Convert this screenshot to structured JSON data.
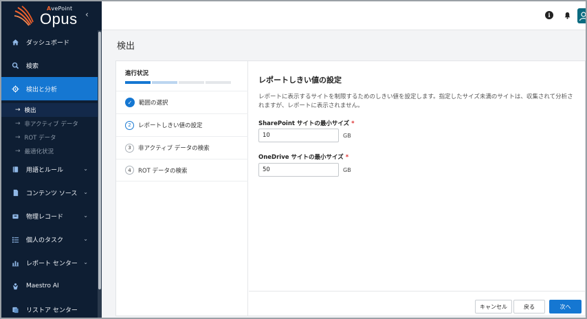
{
  "brand": {
    "company_prefix": "A",
    "company_rest": "vePoint",
    "product": "Opus"
  },
  "sidebar": {
    "collapse_glyph": "‹",
    "items": [
      {
        "label": "ダッシュボード",
        "icon": "home-icon"
      },
      {
        "label": "検索",
        "icon": "search-icon"
      },
      {
        "label": "検出と分析",
        "icon": "target-icon",
        "active": true
      },
      {
        "label": "用語とルール",
        "icon": "book-icon"
      },
      {
        "label": "コンテンツ ソース",
        "icon": "file-icon"
      },
      {
        "label": "物理レコード",
        "icon": "box-icon"
      },
      {
        "label": "個人のタスク",
        "icon": "list-icon"
      },
      {
        "label": "レポート センター",
        "icon": "chart-icon"
      },
      {
        "label": "Maestro AI",
        "icon": "ai-icon"
      },
      {
        "label": "リストア センター",
        "icon": "restore-icon"
      }
    ],
    "subitems": [
      {
        "label": "検出",
        "current": true
      },
      {
        "label": "非アクティブ データ"
      },
      {
        "label": "ROT データ"
      },
      {
        "label": "最適化状況"
      }
    ]
  },
  "page": {
    "title": "検出"
  },
  "wizard": {
    "progress_label": "進行状況",
    "progress": {
      "completed_steps": 1,
      "current_step": 2,
      "total_steps": 4
    },
    "steps": [
      {
        "number": "1",
        "label": "範囲の選択",
        "state": "done"
      },
      {
        "number": "2",
        "label": "レポートしきい値の設定",
        "state": "current"
      },
      {
        "number": "3",
        "label": "非アクティブ データの検索",
        "state": "pending"
      },
      {
        "number": "4",
        "label": "ROT データの検索",
        "state": "pending"
      }
    ]
  },
  "form": {
    "title": "レポートしきい値の設定",
    "description": "レポートに表示するサイトを制限するためのしきい値を設定します。指定したサイズ未満のサイトは、収集されて分析されますが、レポートに表示されません。",
    "sharepoint": {
      "label": "SharePoint サイトの最小サイズ",
      "required_mark": "*",
      "value": "10",
      "unit": "GB"
    },
    "onedrive": {
      "label": "OneDrive サイトの最小サイズ",
      "required_mark": "*",
      "value": "50",
      "unit": "GB"
    }
  },
  "footer": {
    "cancel": "キャンセル",
    "back": "戻る",
    "next": "次へ"
  },
  "colors": {
    "accent": "#1577d2",
    "sidebar_bg": "#0e1e33",
    "brand_orange": "#f0632e"
  }
}
